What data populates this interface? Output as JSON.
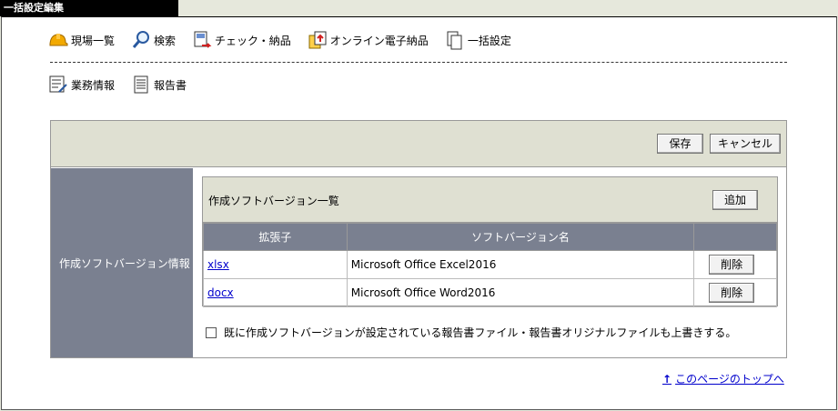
{
  "title": "一括設定編集",
  "toolbar": [
    {
      "label": "現場一覧",
      "icon": "helmet-icon"
    },
    {
      "label": "検索",
      "icon": "magnifier-icon"
    },
    {
      "label": "チェック・納品",
      "icon": "check-delivery-icon"
    },
    {
      "label": "オンライン電子納品",
      "icon": "online-delivery-icon"
    },
    {
      "label": "一括設定",
      "icon": "document-copy-icon"
    }
  ],
  "toolbar2": [
    {
      "label": "業務情報",
      "icon": "task-info-icon"
    },
    {
      "label": "報告書",
      "icon": "report-icon"
    }
  ],
  "actions": {
    "save": "保存",
    "cancel": "キャンセル"
  },
  "section": {
    "label": "作成ソフトバージョン情報",
    "list_title": "作成ソフトバージョン一覧",
    "add": "追加",
    "columns": [
      "拡張子",
      "ソフトバージョン名",
      ""
    ],
    "rows": [
      {
        "ext": "xlsx",
        "name": "Microsoft Office Excel2016",
        "delete": "削除"
      },
      {
        "ext": "docx",
        "name": "Microsoft Office Word2016",
        "delete": "削除"
      }
    ],
    "overwrite_label": "既に作成ソフトバージョンが設定されている報告書ファイル・報告書オリジナルファイルも上書きする。"
  },
  "page_top": "このページのトップへ"
}
